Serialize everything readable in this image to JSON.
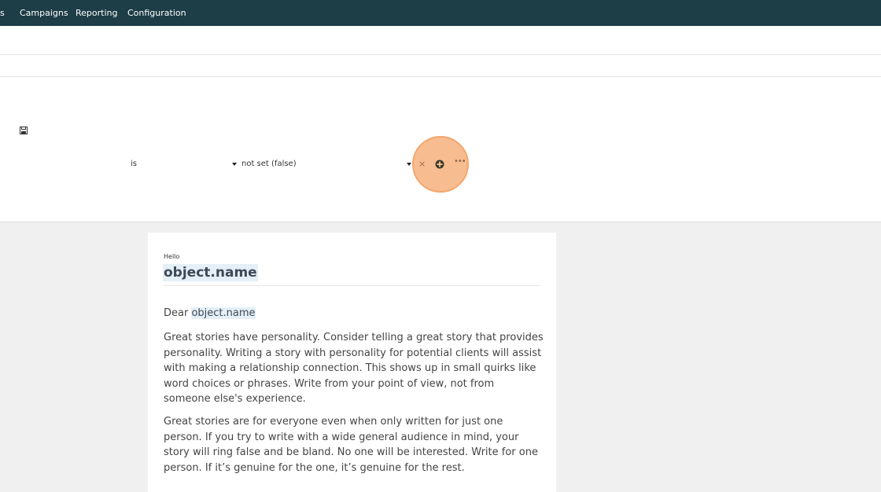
{
  "nav": {
    "items": [
      "s",
      "Campaigns",
      "Reporting",
      "Configuration"
    ]
  },
  "condition": {
    "operator": "is",
    "value": "not set (false)",
    "remove_glyph": "×",
    "more_glyph": "•••",
    "icons": [
      "save-icon",
      "dropdown-caret-icon",
      "close-icon",
      "add-circle-icon",
      "ellipsis-icon"
    ]
  },
  "email": {
    "greeting": "Hello",
    "heading": "object.name",
    "dear_prefix": "Dear ",
    "dear_token": "object.name",
    "para1_lines": [
      "Great stories have personality. Consider telling a great story that provides",
      "personality. Writing a story with personality for potential clients will assist",
      "with making a relationship connection. This shows up in small quirks like",
      "word choices or phrases. Write from your point of view, not from",
      "someone else's experience."
    ],
    "para2_lines": [
      "Great stories are for everyone even when only written for just one",
      "person. If you try to write with a wide general audience in mind, your",
      "story will ring false and be bland. No one will be interested. Write for one",
      "person. If it’s genuine for the one, it’s genuine for the rest."
    ]
  },
  "colors": {
    "nav_bg": "#1d3d47",
    "highlight": "#f7b98a",
    "token_bg": "#e4eff7"
  }
}
